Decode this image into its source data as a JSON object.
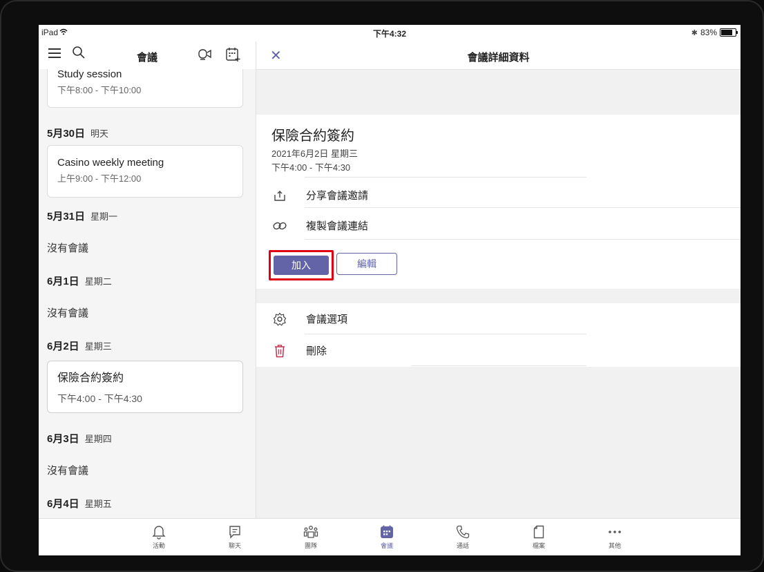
{
  "status": {
    "device": "iPad",
    "time": "下午4:32",
    "battery": "83%"
  },
  "left": {
    "title": "會議",
    "prev_card": {
      "title": "Study session",
      "time": "下午8:00 - 下午10:00"
    },
    "days": [
      {
        "date": "5月30日",
        "weekday": "明天"
      },
      {
        "date": "5月31日",
        "weekday": "星期一"
      },
      {
        "date": "6月1日",
        "weekday": "星期二"
      },
      {
        "date": "6月2日",
        "weekday": "星期三"
      },
      {
        "date": "6月3日",
        "weekday": "星期四"
      },
      {
        "date": "6月4日",
        "weekday": "星期五"
      }
    ],
    "cards": [
      {
        "title": "Casino weekly meeting",
        "time": "上午9:00 - 下午12:00"
      },
      {
        "title": "保險合約簽約",
        "time": "下午4:00 - 下午4:30"
      }
    ],
    "no_meeting": "沒有會議"
  },
  "right": {
    "title": "會議詳細資料",
    "meeting_title": "保險合約簽約",
    "meeting_date": "2021年6月2日 星期三",
    "meeting_time": "下午4:00 - 下午4:30",
    "share_label": "分享會議邀請",
    "copy_label": "複製會議連結",
    "join_label": "加入",
    "edit_label": "編輯",
    "options_label": "會議選項",
    "delete_label": "刪除"
  },
  "tabs": [
    {
      "label": "活動",
      "icon": "bell-icon"
    },
    {
      "label": "聊天",
      "icon": "chat-icon"
    },
    {
      "label": "團隊",
      "icon": "teams-icon"
    },
    {
      "label": "會議",
      "icon": "calendar-icon"
    },
    {
      "label": "通話",
      "icon": "phone-icon"
    },
    {
      "label": "檔案",
      "icon": "file-icon"
    },
    {
      "label": "其他",
      "icon": "more-icon"
    }
  ],
  "colors": {
    "accent": "#6264a7",
    "highlight": "#e00012",
    "delete": "#c4314b"
  }
}
